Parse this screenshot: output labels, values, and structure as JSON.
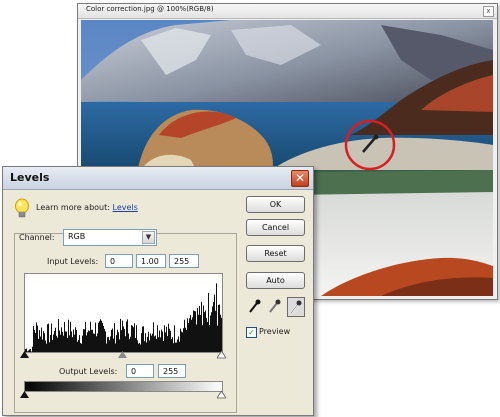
{
  "image_window": {
    "title": "Color correction.jpg @ 100%(RGB/8)",
    "close_glyph": "x"
  },
  "dialog": {
    "title": "Levels",
    "close_glyph": "✕",
    "learn_prefix": "Learn more about:",
    "learn_link": "Levels",
    "channel_label": "Channel:",
    "channel_value": "RGB",
    "input_levels_label": "Input Levels:",
    "input_levels": [
      "0",
      "1.00",
      "255"
    ],
    "output_levels_label": "Output Levels:",
    "output_levels": [
      "0",
      "255"
    ],
    "buttons": {
      "ok": "OK",
      "cancel": "Cancel",
      "reset": "Reset",
      "auto": "Auto"
    },
    "preview_label": "Preview",
    "preview_checked": true
  },
  "colors": {
    "dialog_bg": "#ece9d8",
    "link": "#1a3fa8",
    "close_red": "#c2401f",
    "highlight_circle": "#d42020"
  }
}
